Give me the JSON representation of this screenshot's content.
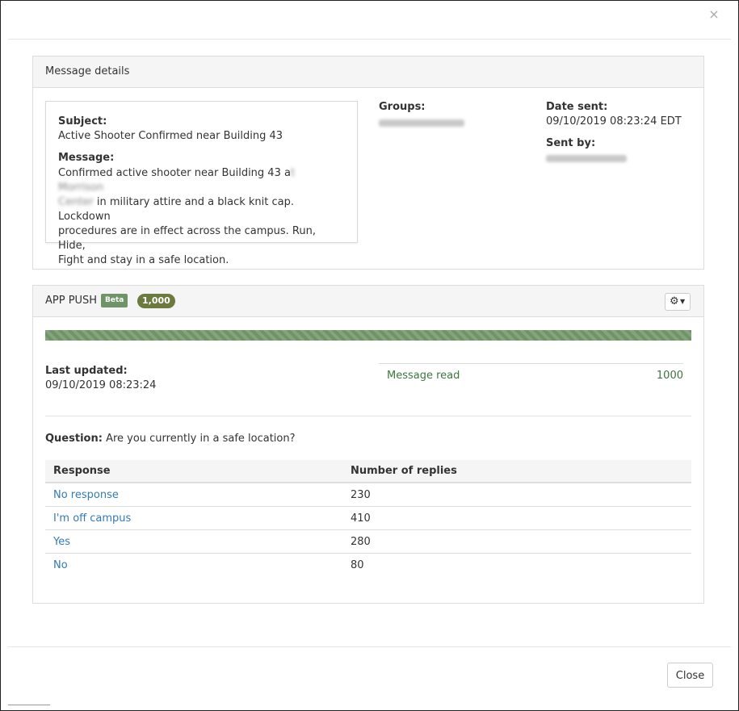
{
  "modal": {
    "close_x": "×",
    "close_button": "Close"
  },
  "details": {
    "heading": "Message details",
    "subject_label": "Subject:",
    "subject": "Active Shooter Confirmed near Building 43",
    "message_label": "Message:",
    "message_line1": "Confirmed active shooter near Building 43 a",
    "message_line1_redacted": "t Morrison",
    "message_line2_redacted": "Center",
    "message_line2": " in military attire and a black knit cap. Lockdown",
    "message_line3": "procedures are in effect across the campus. Run, Hide,",
    "message_line4": "Fight and stay in a safe location.",
    "groups_label": "Groups:",
    "date_sent_label": "Date sent:",
    "date_sent": "09/10/2019 08:23:24 EDT",
    "sent_by_label": "Sent by:"
  },
  "push": {
    "heading": "APP PUSH",
    "beta_badge": "Beta",
    "count_badge": "1,000",
    "gear_icon": "⚙",
    "caret_icon": "▼",
    "progress_fraction": 1.0,
    "progress_color": "#6f9466",
    "last_updated_label": "Last updated:",
    "last_updated": "09/10/2019 08:23:24",
    "read_label": "Message read",
    "read_value": "1000",
    "question_label": "Question:",
    "question": "Are you currently in a safe location?",
    "table": {
      "headers": [
        "Response",
        "Number of replies"
      ],
      "rows": [
        {
          "response": "No response",
          "replies": "230"
        },
        {
          "response": "I'm off campus",
          "replies": "410"
        },
        {
          "response": "Yes",
          "replies": "280"
        },
        {
          "response": "No",
          "replies": "80"
        }
      ]
    }
  },
  "colors": {
    "link": "#337ab7",
    "success": "#3c763d",
    "badge_count": "#6b7a3e"
  }
}
